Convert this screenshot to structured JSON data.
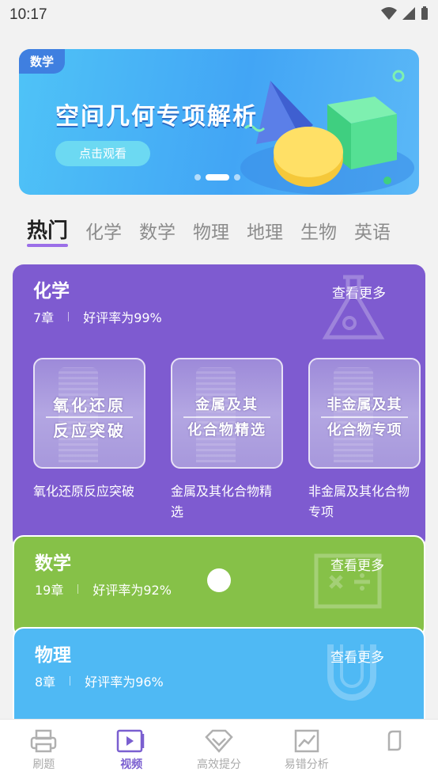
{
  "status": {
    "time": "10:17"
  },
  "banner": {
    "tag": "数学",
    "title": "空间几何专项解析",
    "button": "点击观看"
  },
  "tabs": [
    "热门",
    "化学",
    "数学",
    "物理",
    "地理",
    "生物",
    "英语"
  ],
  "cards": {
    "chemistry": {
      "title": "化学",
      "chapters": "7章",
      "rating": "好评率为99%",
      "more": "查看更多",
      "courses": [
        {
          "thumb_line1": "氧化还原",
          "thumb_line2": "反应突破",
          "name": "氧化还原反应突破"
        },
        {
          "thumb_line1": "金属及其",
          "thumb_line2": "化合物精选",
          "name": "金属及其化合物精选"
        },
        {
          "thumb_line1": "非金属及其",
          "thumb_line2": "化合物专项",
          "name": "非金属及其化合物专项"
        }
      ]
    },
    "math": {
      "title": "数学",
      "chapters": "19章",
      "rating": "好评率为92%",
      "more": "查看更多"
    },
    "physics": {
      "title": "物理",
      "chapters": "8章",
      "rating": "好评率为96%",
      "more": "查看更多"
    }
  },
  "bottom_nav": [
    {
      "label": "刷题",
      "icon": "printer-icon"
    },
    {
      "label": "视频",
      "icon": "video-icon",
      "active": true
    },
    {
      "label": "高效提分",
      "icon": "diamond-icon"
    },
    {
      "label": "易错分析",
      "icon": "chart-icon"
    },
    {
      "label": "",
      "icon": "note-icon"
    }
  ],
  "colors": {
    "chemistry": "#7e5bd0",
    "math": "#86c148",
    "physics": "#4fb9f4",
    "accent": "#7a5fd0"
  }
}
